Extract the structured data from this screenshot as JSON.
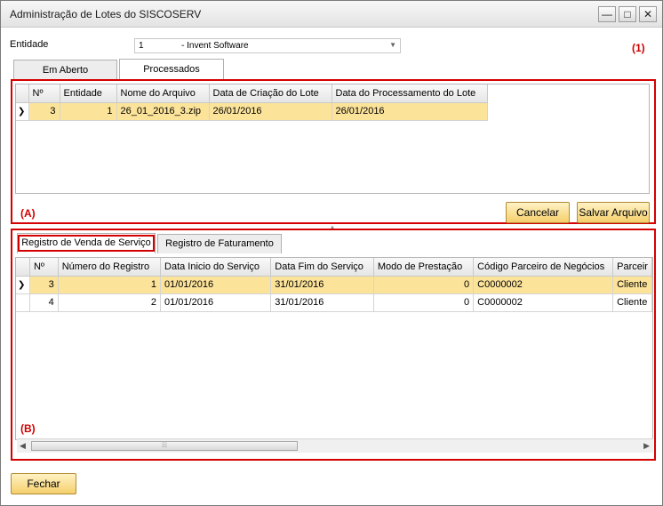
{
  "window": {
    "title": "Administração de Lotes do SISCOSERV",
    "minimize": "—",
    "maximize": "□",
    "close": "✕"
  },
  "entidade": {
    "label": "Entidade",
    "value_code": "1",
    "value_name": "- Invent Software"
  },
  "annotations": {
    "one": "(1)",
    "a": "(A)",
    "b": "(B)"
  },
  "top_tabs": [
    "Em Aberto",
    "Processados"
  ],
  "lots": {
    "headers": [
      "Nº",
      "Entidade",
      "Nome do Arquivo",
      "Data de Criação do Lote",
      "Data do Processamento do Lote"
    ],
    "rows": [
      [
        "3",
        "1",
        "26_01_2016_3.zip",
        "26/01/2016",
        "26/01/2016"
      ]
    ]
  },
  "buttons": {
    "cancel": "Cancelar",
    "save": "Salvar Arquivo",
    "close": "Fechar"
  },
  "bottom_tabs": [
    "Registro de Venda de Serviço",
    "Registro de Faturamento"
  ],
  "records": {
    "headers": [
      "Nº",
      "Número do Registro",
      "Data Inicio do Serviço",
      "Data Fim do Serviço",
      "Modo de Prestação",
      "Código Parceiro de Negócios",
      "Parceir"
    ],
    "rows": [
      [
        "3",
        "1",
        "01/01/2016",
        "31/01/2016",
        "0",
        "C0000002",
        "Cliente"
      ],
      [
        "4",
        "2",
        "01/01/2016",
        "31/01/2016",
        "0",
        "C0000002",
        "Cliente"
      ]
    ]
  },
  "colors": {
    "highlight": "#fce39a",
    "button": "#f5cf6c",
    "annotation_red": "#d40000"
  }
}
